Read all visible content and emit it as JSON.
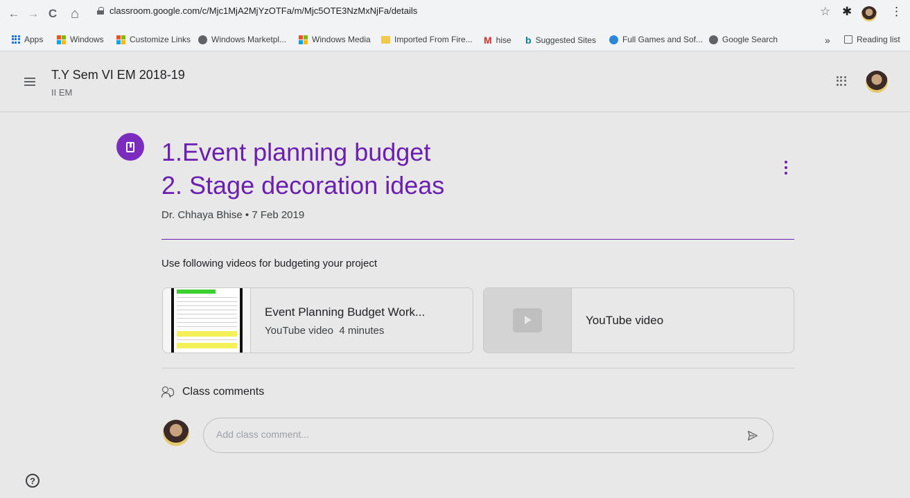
{
  "browser": {
    "url": "classroom.google.com/c/Mjc1MjA2MjYzOTFa/m/Mjc5OTE3NzMxNjFa/details",
    "back_glyph": "←",
    "forward_glyph": "→",
    "reload_glyph": "C",
    "home_glyph": "⌂",
    "star_glyph": "☆",
    "extensions_glyph": "✱",
    "menu_glyph": "⋮"
  },
  "bookmarks": {
    "items": [
      {
        "label": "Apps",
        "icon": "apps-grid-icon"
      },
      {
        "label": "Windows",
        "icon": "windows-logo-icon"
      },
      {
        "label": "Customize Links",
        "icon": "windows-logo-icon"
      },
      {
        "label": "Windows Marketpl...",
        "icon": "globe-icon"
      },
      {
        "label": "Windows Media",
        "icon": "windows-logo-icon"
      },
      {
        "label": "Imported From Fire...",
        "icon": "folder-icon"
      },
      {
        "label": "hise",
        "icon": "gmail-icon"
      },
      {
        "label": "Suggested Sites",
        "icon": "bing-icon"
      },
      {
        "label": "Full Games and Sof...",
        "icon": "ie-globe-icon"
      },
      {
        "label": "Google Search",
        "icon": "globe-icon"
      }
    ],
    "overflow": "»",
    "reading_list": "Reading list"
  },
  "classroom": {
    "title": "T.Y Sem VI EM 2018-19",
    "section": "II EM"
  },
  "post": {
    "title_line1": "1.Event planning budget",
    "title_line2": "2. Stage decoration ideas",
    "meta": "Dr. Chhaya Bhise • 7 Feb 2019",
    "description": "Use following videos for budgeting your project",
    "accent_color": "#6a1fb0"
  },
  "attachments": [
    {
      "title": "Event Planning Budget Work...",
      "type": "YouTube video",
      "duration": "4 minutes"
    },
    {
      "title": "YouTube video"
    }
  ],
  "comments": {
    "header": "Class comments",
    "placeholder": "Add class comment..."
  },
  "help_label": "?"
}
